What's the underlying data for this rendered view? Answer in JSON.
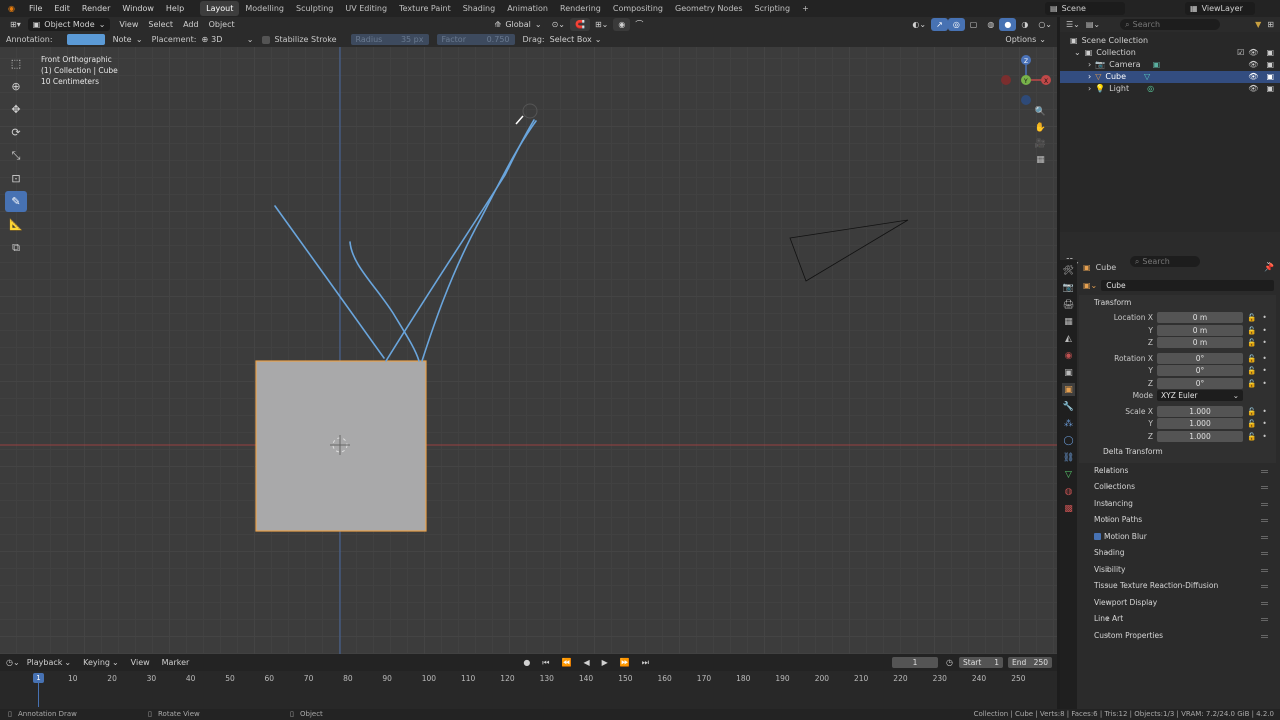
{
  "topbar": {
    "menus": [
      "File",
      "Edit",
      "Render",
      "Window",
      "Help"
    ],
    "workspaces": [
      "Layout",
      "Modelling",
      "Sculpting",
      "UV Editing",
      "Texture Paint",
      "Shading",
      "Animation",
      "Rendering",
      "Compositing",
      "Geometry Nodes",
      "Scripting"
    ],
    "active_workspace": "Layout",
    "add_symbol": "+",
    "scene_label": "Scene",
    "viewlayer_label": "ViewLayer"
  },
  "header": {
    "mode": "Object Mode",
    "menus": [
      "View",
      "Select",
      "Add",
      "Object"
    ],
    "orientation": "Global"
  },
  "toolsettings": {
    "annotation_label": "Annotation:",
    "annotation_color": "#5b9ad6",
    "note_label": "Note",
    "placement_label": "Placement:",
    "placement_value": "3D Cursor",
    "stabilize_label": "Stabilize Stroke",
    "radius_label": "Radius",
    "radius_value": "35 px",
    "factor_label": "Factor",
    "factor_value": "0.750",
    "drag_label": "Drag:",
    "drag_value": "Select Box",
    "options_label": "Options"
  },
  "viewport": {
    "view_name": "Front Orthographic",
    "collection_info": "(1) Collection | Cube",
    "scale_info": "10 Centimeters",
    "gizmo_axes": {
      "z": "Z",
      "y": "Y",
      "x": "X"
    }
  },
  "outliner": {
    "search_placeholder": "Search",
    "root": "Scene Collection",
    "collection": "Collection",
    "items": [
      "Camera",
      "Cube",
      "Light"
    ],
    "selected": "Cube"
  },
  "properties": {
    "search_placeholder": "Search",
    "object_name": "Cube",
    "datablock": "Cube",
    "transform_title": "Transform",
    "location_label": "Location X",
    "y_label": "Y",
    "z_label": "Z",
    "location": [
      "0 m",
      "0 m",
      "0 m"
    ],
    "rotation_label": "Rotation X",
    "rotation": [
      "0°",
      "0°",
      "0°"
    ],
    "mode_label": "Mode",
    "mode_value": "XYZ Euler",
    "scale_label": "Scale X",
    "scale": [
      "1.000",
      "1.000",
      "1.000"
    ],
    "delta_label": "Delta Transform",
    "panels": [
      "Relations",
      "Collections",
      "Instancing",
      "Motion Paths",
      "Motion Blur",
      "Shading",
      "Visibility",
      "Tissue Texture Reaction-Diffusion",
      "Viewport Display",
      "Line Art",
      "Custom Properties"
    ]
  },
  "timeline": {
    "menus": [
      "Playback",
      "Keying",
      "View",
      "Marker"
    ],
    "current_frame": "1",
    "start_label": "Start",
    "start_value": "1",
    "end_label": "End",
    "end_value": "250",
    "ticks": [
      "10",
      "20",
      "30",
      "40",
      "50",
      "60",
      "70",
      "80",
      "90",
      "100",
      "110",
      "120",
      "130",
      "140",
      "150",
      "160",
      "170",
      "180",
      "190",
      "200",
      "210",
      "220",
      "230",
      "240",
      "250"
    ]
  },
  "statusbar": {
    "left1": "Annotation Draw",
    "left2": "Rotate View",
    "left3": "Object",
    "right": "Collection | Cube | Verts:8 | Faces:6 | Tris:12 | Objects:1/3 | VRAM: 7.2/24.0 GiB | 4.2.0"
  },
  "colors": {
    "accent": "#4772b3",
    "selected_outline": "#e8a14a",
    "annotation": "#5b9ad6",
    "x_axis": "#b04040",
    "y_axis": "#4a72b8"
  }
}
